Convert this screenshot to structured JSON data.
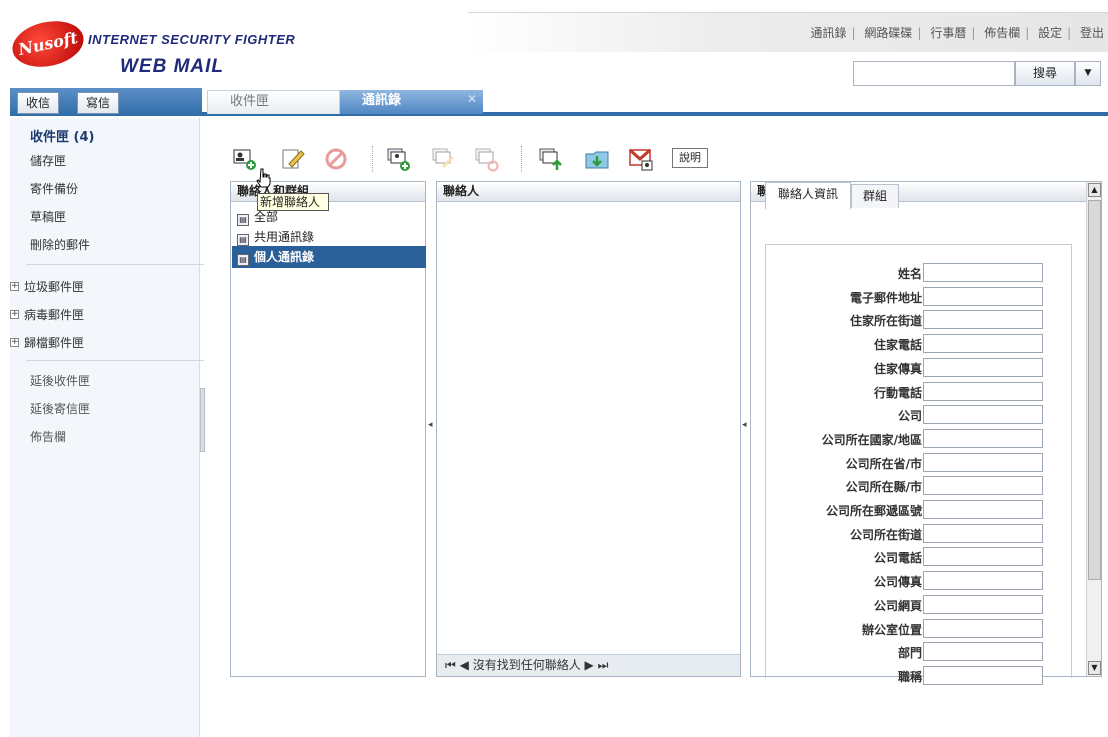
{
  "brand": {
    "mark": "Nusoft",
    "line1": "INTERNET SECURITY FIGHTER",
    "line2": "WEB MAIL"
  },
  "toplinks": [
    "通訊錄",
    "網路碟碟",
    "行事曆",
    "佈告欄",
    "設定",
    "登出"
  ],
  "search": {
    "value": "",
    "button": "搜尋"
  },
  "left_buttons": {
    "receive": "收信",
    "compose": "寫信"
  },
  "tabs": {
    "inbox": "收件匣",
    "contacts": "通訊錄"
  },
  "sidebar": {
    "inbox": "收件匣 (4)",
    "items": [
      "儲存匣",
      "寄件備份",
      "草稿匣",
      "刪除的郵件"
    ],
    "folders": [
      "垃圾郵件匣",
      "病毒郵件匣",
      "歸檔郵件匣"
    ],
    "delayed": [
      "延後收件匣",
      "延後寄信匣",
      "佈告欄"
    ]
  },
  "toolbar": {
    "help": "說明",
    "tooltip": "新增聯絡人"
  },
  "groups_panel": {
    "title": "聯絡人和群組",
    "items": [
      "全部",
      "共用通訊錄",
      "個人通訊錄"
    ]
  },
  "contacts_panel": {
    "title": "聯絡人",
    "pager": "沒有找到任何聯絡人"
  },
  "info_panel": {
    "title": "聯絡人資訊設定",
    "tabs": [
      "聯絡人資訊",
      "群組"
    ],
    "fields": [
      "姓名",
      "電子郵件地址",
      "住家所在街道",
      "住家電話",
      "住家傳真",
      "行動電話",
      "公司",
      "公司所在國家/地區",
      "公司所在省/市",
      "公司所在縣/市",
      "公司所在郵遞區號",
      "公司所在街道",
      "公司電話",
      "公司傳真",
      "公司網頁",
      "辦公室位置",
      "部門",
      "職稱"
    ]
  }
}
